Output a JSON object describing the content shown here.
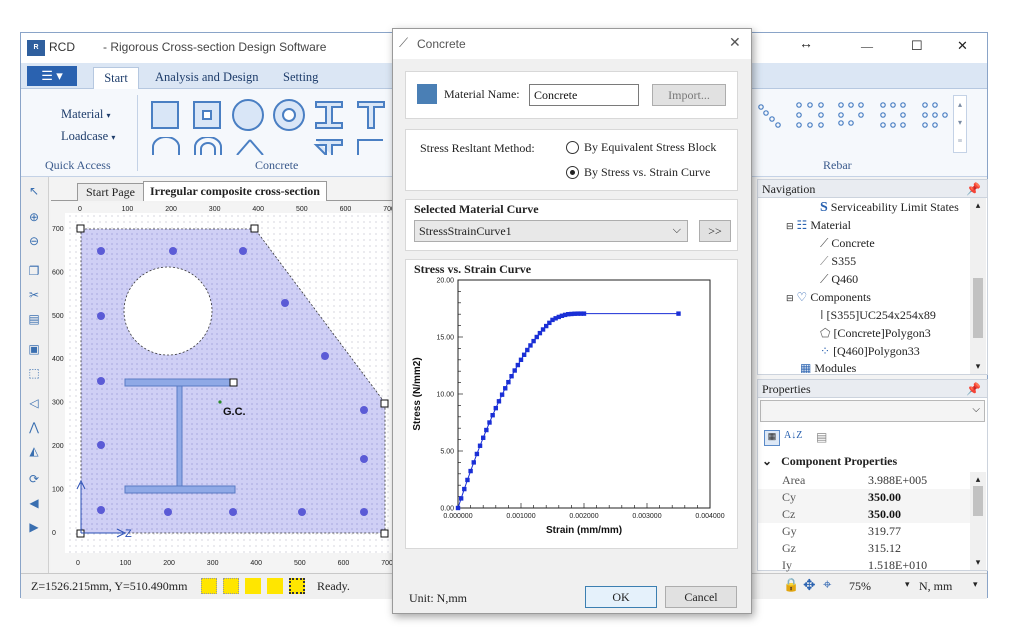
{
  "app": {
    "logo": "RCD",
    "title": "- Rigorous Cross-section Design Software",
    "window_controls": {
      "resize": "↔",
      "minimize": "—",
      "maximize": "☐",
      "close": "✕"
    }
  },
  "ribbon": {
    "menu_button": "☰",
    "tabs": [
      {
        "label": "Start"
      },
      {
        "label": "Analysis and Design"
      },
      {
        "label": "Setting"
      }
    ],
    "quick_access": {
      "material": "Material",
      "loadcase": "Loadcase",
      "label": "Quick Access"
    },
    "concrete_group_label": "Concrete",
    "rebar_group_label": "Rebar"
  },
  "doc_tabs": [
    {
      "label": "Start Page"
    },
    {
      "label": "Irregular composite cross-section"
    }
  ],
  "canvas": {
    "gc_label": "G.C.",
    "axis_z": "Z",
    "x_ticks": [
      "0",
      "100",
      "200",
      "300",
      "400",
      "500",
      "600",
      "700"
    ],
    "y_ticks": [
      "700",
      "600",
      "500",
      "400",
      "300",
      "200",
      "100",
      "0"
    ]
  },
  "status": {
    "coords": "Z=1526.215mm, Y=510.490mm",
    "state": "Ready.",
    "zoom": "75%",
    "unit": "N, mm"
  },
  "dialog": {
    "title": "Concrete",
    "close": "✕",
    "material_name_label": "Material Name:",
    "material_name_value": "Concrete",
    "import_button": "Import...",
    "stress_method_label": "Stress Resltant Method:",
    "method_options": [
      "By Equivalent Stress Block",
      "By Stress vs. Strain Curve"
    ],
    "selected_method_index": 1,
    "selected_curve_header": "Selected Material Curve",
    "selected_curve_value": "StressStrainCurve1",
    "curve_more_button": ">>",
    "chart_header": "Stress vs. Strain Curve",
    "unit_text": "Unit: N,mm",
    "ok_button": "OK",
    "cancel_button": "Cancel",
    "swatch_color": "#4a7fb5"
  },
  "chart_data": {
    "type": "line",
    "title": "",
    "xlabel": "Strain (mm/mm)",
    "ylabel": "Stress (N/mm2)",
    "xlim": [
      0,
      0.004
    ],
    "ylim": [
      0,
      20
    ],
    "x_tick_labels": [
      "0.000000",
      "0.001000",
      "0.002000",
      "0.003000",
      "0.004000"
    ],
    "y_tick_labels": [
      "0.00",
      "5.00",
      "10.00",
      "15.00",
      "20.00"
    ],
    "series": [
      {
        "x": [
          0,
          5e-05,
          0.0001,
          0.00015,
          0.0002,
          0.00025,
          0.0003,
          0.00035,
          0.0004,
          0.00045,
          0.0005,
          0.00055,
          0.0006,
          0.00065,
          0.0007,
          0.00075,
          0.0008,
          0.00085,
          0.0009,
          0.00095,
          0.001,
          0.00105,
          0.0011,
          0.00115,
          0.0012,
          0.00125,
          0.0013,
          0.00135,
          0.0014,
          0.00145,
          0.0015,
          0.00155,
          0.0016,
          0.00165,
          0.0017,
          0.00175,
          0.0018,
          0.00185,
          0.0019,
          0.00195,
          0.002,
          0.0035
        ],
        "y": [
          0,
          0.84,
          1.66,
          2.46,
          3.24,
          4.0,
          4.74,
          5.46,
          6.16,
          6.84,
          7.5,
          8.14,
          8.76,
          9.36,
          9.94,
          10.5,
          11.04,
          11.56,
          12.06,
          12.54,
          13.0,
          13.44,
          13.86,
          14.26,
          14.64,
          15.0,
          15.34,
          15.66,
          15.96,
          16.24,
          16.5,
          16.64,
          16.76,
          16.86,
          16.94,
          17.0,
          17.02,
          17.04,
          17.05,
          17.05,
          17.05,
          17.05
        ],
        "color": "#1a2fd6"
      }
    ]
  },
  "navigation": {
    "title": "Navigation",
    "items": [
      {
        "label": "Serviceability Limit States"
      },
      {
        "label": "Material"
      },
      {
        "label": "Concrete"
      },
      {
        "label": "S355"
      },
      {
        "label": "Q460"
      },
      {
        "label": "Components"
      },
      {
        "label": "[S355]UC254x254x89"
      },
      {
        "label": "[Concrete]Polygon3"
      },
      {
        "label": "[Q460]Polygon33"
      },
      {
        "label": "Modules"
      }
    ]
  },
  "properties": {
    "title": "Properties",
    "section": "Component Properties",
    "rows": [
      {
        "k": "Area",
        "v": "3.988E+005",
        "bold": false
      },
      {
        "k": "Cy",
        "v": "350.00",
        "bold": true
      },
      {
        "k": "Cz",
        "v": "350.00",
        "bold": true
      },
      {
        "k": "Gy",
        "v": "319.77",
        "bold": false
      },
      {
        "k": "Gz",
        "v": "315.12",
        "bold": false
      },
      {
        "k": "Iy",
        "v": "1.518E+010",
        "bold": false
      }
    ]
  }
}
